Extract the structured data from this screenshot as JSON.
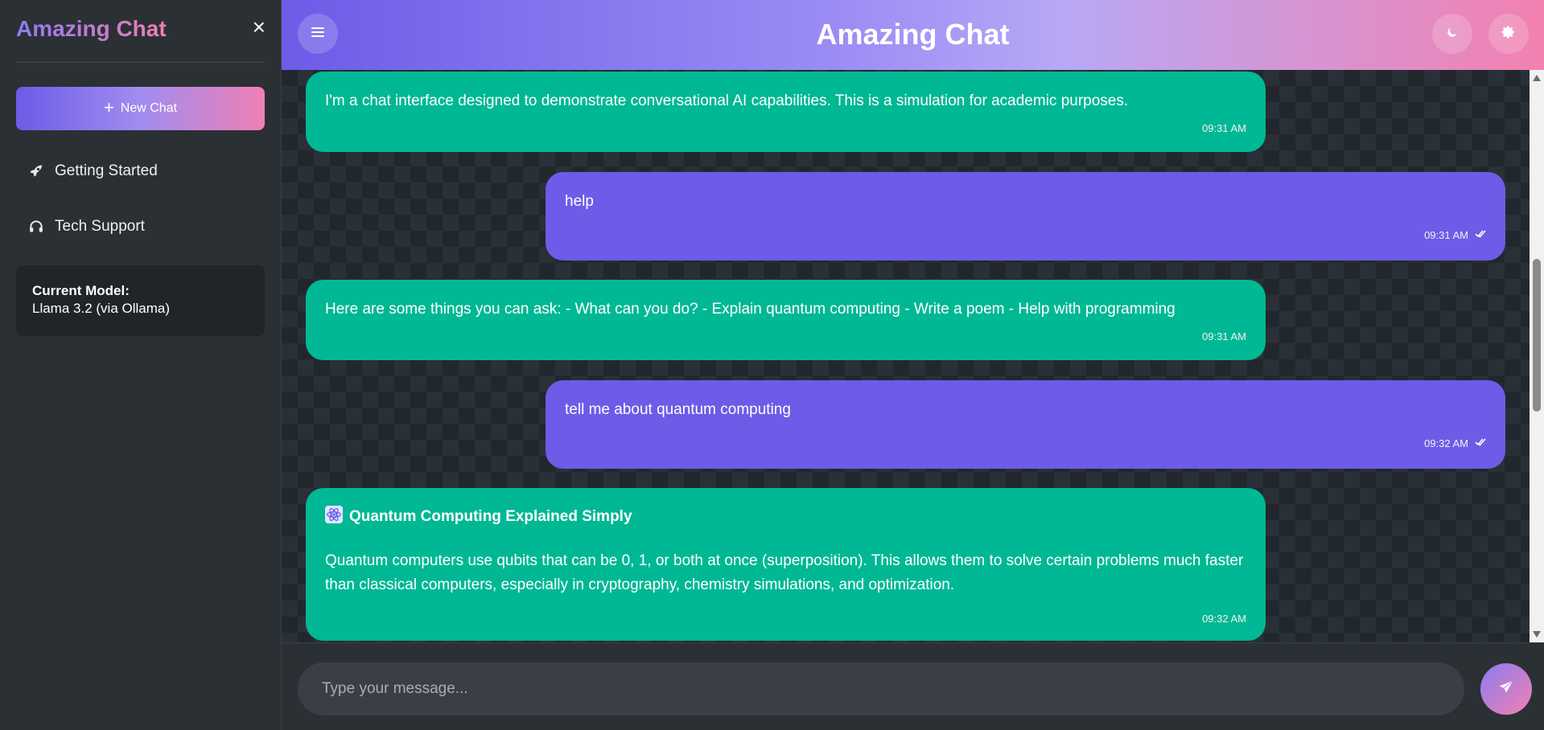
{
  "sidebar": {
    "title": "Amazing Chat",
    "close_icon": "×",
    "new_chat_label": "New Chat",
    "items": [
      {
        "label": "Getting Started",
        "icon": "rocket-icon"
      },
      {
        "label": "Tech Support",
        "icon": "headset-icon"
      }
    ],
    "model": {
      "label": "Current Model:",
      "value": "Llama 3.2 (via Ollama)"
    }
  },
  "header": {
    "title": "Amazing Chat",
    "menu_icon": "menu-icon",
    "theme_icon": "moon-icon",
    "settings_icon": "gear-icon"
  },
  "messages": [
    {
      "role": "bot",
      "text": "I'm a chat interface designed to demonstrate conversational AI capabilities. This is a simulation for academic purposes.",
      "time": "09:31 AM"
    },
    {
      "role": "user",
      "text": "help",
      "time": "09:31 AM",
      "status_icon": "double-check-icon"
    },
    {
      "role": "bot",
      "text": "Here are some things you can ask: - What can you do? - Explain quantum computing - Write a poem - Help with programming",
      "time": "09:31 AM"
    },
    {
      "role": "user",
      "text": "tell me about quantum computing",
      "time": "09:32 AM",
      "status_icon": "double-check-icon"
    },
    {
      "role": "bot",
      "heading": "Quantum Computing Explained Simply",
      "heading_icon": "atom-icon",
      "text": "Quantum computers use qubits that can be 0, 1, or both at once (superposition). This allows them to solve certain problems much faster than classical computers, especially in cryptography, chemistry simulations, and optimization.",
      "time": "09:32 AM"
    }
  ],
  "input": {
    "placeholder": "Type your message...",
    "value": "",
    "send_icon": "paper-plane-icon"
  },
  "colors": {
    "bot_bubble": "#00b894",
    "user_bubble": "#6c5ce7",
    "sidebar_bg": "#2b3035",
    "chat_bg": "#22272e",
    "accent_start": "#6c5ce7",
    "accent_end": "#f281b0"
  }
}
